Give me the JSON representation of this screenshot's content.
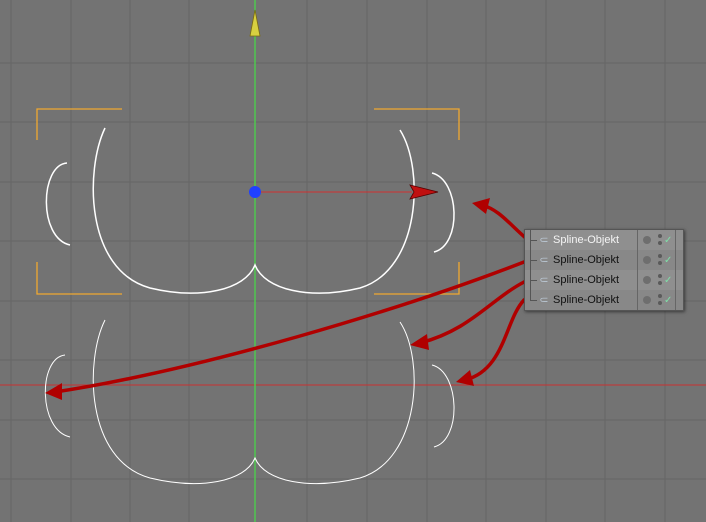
{
  "objects": [
    {
      "label": "Spline-Objekt",
      "selected": true,
      "check_icon": "checkmark-icon"
    },
    {
      "label": "Spline-Objekt",
      "selected": false,
      "check_icon": "checkmark-icon"
    },
    {
      "label": "Spline-Objekt",
      "selected": false,
      "check_icon": "checkmark-icon"
    },
    {
      "label": "Spline-Objekt",
      "selected": false,
      "check_icon": "checkmark-icon"
    }
  ],
  "colors": {
    "background": "#737373",
    "grid": "#666666",
    "y_axis": "#4fc84f",
    "x_axis": "#c83232",
    "bbox": "#f0a830",
    "spline": "#ffffff",
    "arrow": "#b00000",
    "handle": "#2040ff"
  }
}
